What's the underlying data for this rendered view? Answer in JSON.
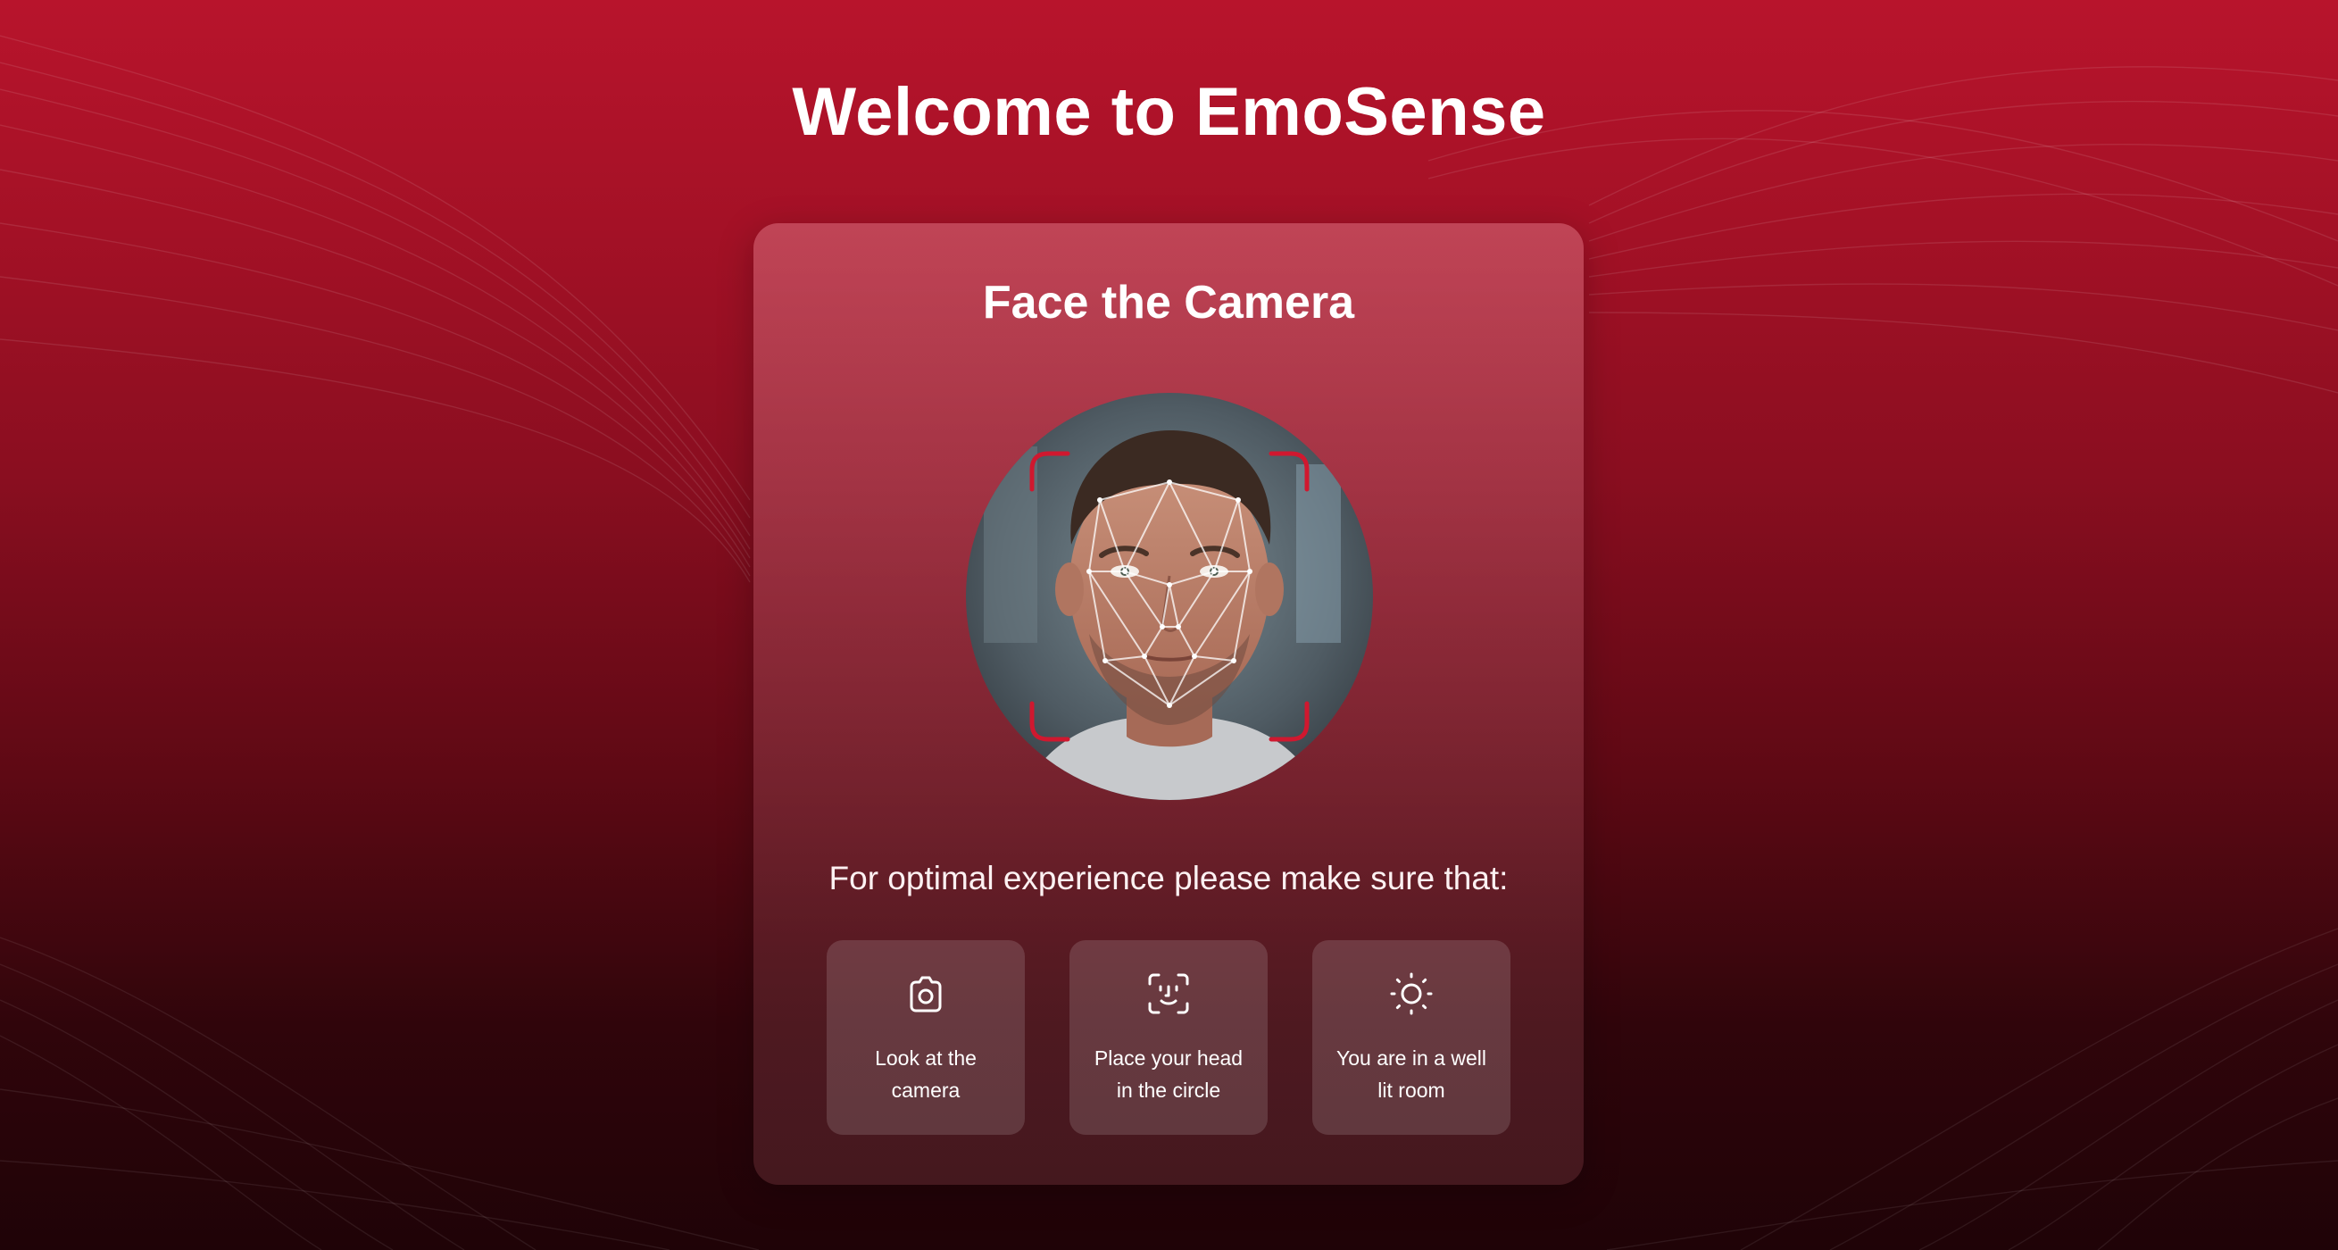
{
  "header": {
    "title": "Welcome to EmoSense"
  },
  "card": {
    "title": "Face the Camera",
    "avatar_description_icon": "face-scan-photo",
    "instructions": "For optimal experience please make sure that:",
    "tips": [
      {
        "icon": "camera-icon",
        "label": "Look at the camera"
      },
      {
        "icon": "face-id-icon",
        "label": "Place your head in the circle"
      },
      {
        "icon": "sun-icon",
        "label": "You are in a well lit room"
      }
    ]
  },
  "colors": {
    "brand_red": "#b8142c",
    "frame_corner_red": "#d0182f",
    "text": "#ffffff"
  }
}
